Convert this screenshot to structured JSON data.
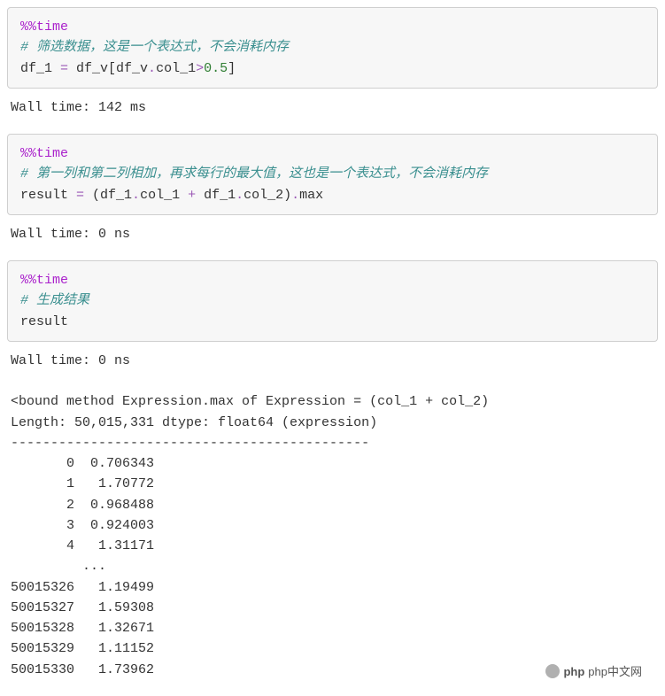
{
  "cells": [
    {
      "code_html": "<span class='magic'>%%</span><span class='magic'>time</span>\n<span class='comment'># 筛选数据，这是一个表达式，不会消耗内存</span>\ndf_1 <span class='operator'>=</span> df_v[df_v<span class='operator'>.</span>col_1<span class='operator'>&gt;</span><span class='number'>0.5</span>]",
      "output": "Wall time: 142 ms"
    },
    {
      "code_html": "<span class='magic'>%%</span><span class='magic'>time</span>\n<span class='comment'># 第一列和第二列相加，再求每行的最大值，这也是一个表达式，不会消耗内存</span>\nresult <span class='operator'>=</span> (df_1<span class='operator'>.</span>col_1 <span class='operator'>+</span> df_1<span class='operator'>.</span>col_2)<span class='operator'>.</span>max",
      "output": "Wall time: 0 ns"
    },
    {
      "code_html": "<span class='magic'>%%</span><span class='magic'>time</span>\n<span class='comment'># 生成结果</span>\nresult",
      "output": "Wall time: 0 ns\n\n<bound method Expression.max of Expression = (col_1 + col_2)\nLength: 50,015,331 dtype: float64 (expression)\n---------------------------------------------\n       0  0.706343\n       1   1.70772\n       2  0.968488\n       3  0.924003\n       4   1.31171\n         ...\n50015326   1.19499\n50015327   1.59308\n50015328   1.32671\n50015329   1.11152\n50015330   1.73962"
    }
  ],
  "footer": {
    "text": "php中文网"
  },
  "chart_data": {
    "type": "table",
    "description": "Expression repr output; head and tail rows of float64 series of length 50,015,331",
    "length": 50015331,
    "dtype": "float64",
    "expression": "col_1 + col_2",
    "head": [
      {
        "index": 0,
        "value": 0.706343
      },
      {
        "index": 1,
        "value": 1.70772
      },
      {
        "index": 2,
        "value": 0.968488
      },
      {
        "index": 3,
        "value": 0.924003
      },
      {
        "index": 4,
        "value": 1.31171
      }
    ],
    "tail": [
      {
        "index": 50015326,
        "value": 1.19499
      },
      {
        "index": 50015327,
        "value": 1.59308
      },
      {
        "index": 50015328,
        "value": 1.32671
      },
      {
        "index": 50015329,
        "value": 1.11152
      },
      {
        "index": 50015330,
        "value": 1.73962
      }
    ]
  }
}
